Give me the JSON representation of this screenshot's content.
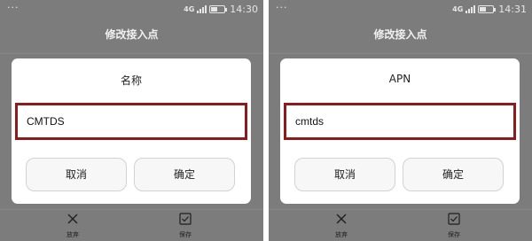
{
  "screens": [
    {
      "status": {
        "dots": "···",
        "network": "4G",
        "time": "14:30"
      },
      "header": {
        "title": "修改接入点"
      },
      "dialog": {
        "title": "名称",
        "input_value": "CMTDS",
        "cancel_label": "取消",
        "confirm_label": "确定"
      },
      "bottom": {
        "discard_label": "放弃",
        "save_label": "保存"
      }
    },
    {
      "status": {
        "dots": "···",
        "network": "4G",
        "time": "14:31"
      },
      "header": {
        "title": "修改接入点"
      },
      "dialog": {
        "title": "APN",
        "input_value": "cmtds",
        "cancel_label": "取消",
        "confirm_label": "确定"
      },
      "bottom": {
        "discard_label": "放弃",
        "save_label": "保存"
      }
    }
  ],
  "colors": {
    "overlay": "#7c7c7c",
    "highlight_border": "#8e1b1b",
    "dialog_bg": "#ffffff"
  },
  "icons": {
    "discard": "close-icon",
    "save": "check-icon"
  }
}
